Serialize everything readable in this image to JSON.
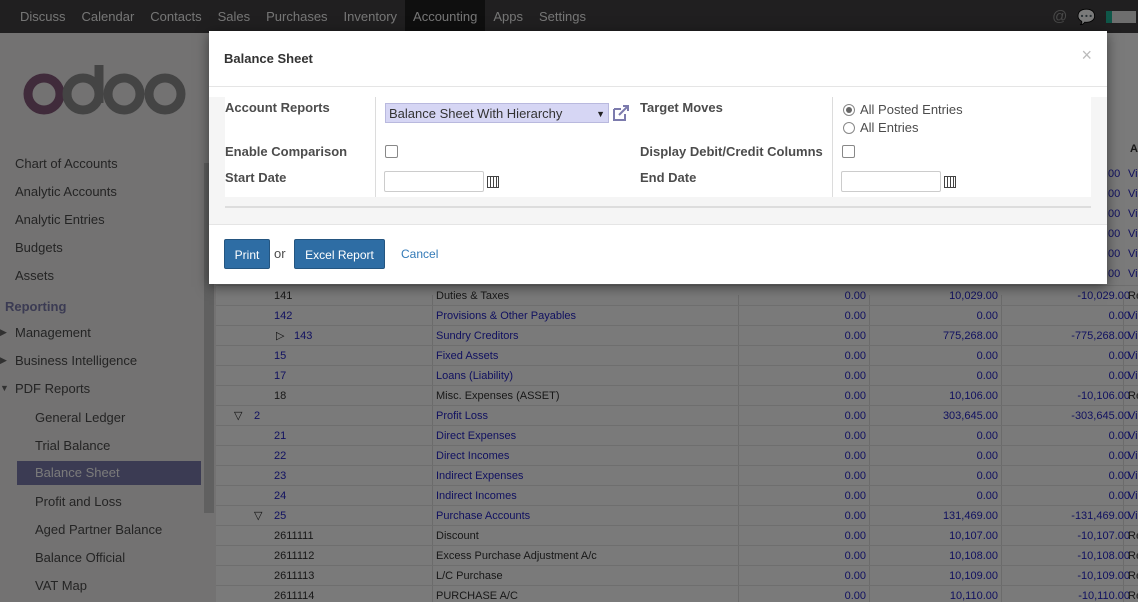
{
  "topbar": {
    "menu": [
      "Discuss",
      "Calendar",
      "Contacts",
      "Sales",
      "Purchases",
      "Inventory",
      "Accounting",
      "Apps",
      "Settings"
    ],
    "active": "Accounting",
    "icons": [
      "at-icon",
      "chat-icon"
    ]
  },
  "sidebar": {
    "logo": "odoo",
    "items": [
      "Chart of Accounts",
      "Analytic Accounts",
      "Analytic Entries",
      "Budgets",
      "Assets"
    ],
    "reporting_header": "Reporting",
    "groups": [
      "Management",
      "Business Intelligence",
      "PDF Reports"
    ],
    "pdf_reports": [
      "General Ledger",
      "Trial Balance",
      "Balance Sheet",
      "Profit and Loss",
      "Aged Partner Balance",
      "Balance Official",
      "VAT Map"
    ],
    "active": "Balance Sheet"
  },
  "table": {
    "rows": [
      {
        "code": "141",
        "name": "Duties & Taxes",
        "a": "0.00",
        "b": "10,029.00",
        "c": "-10,029.00",
        "v": "Re",
        "link": false
      },
      {
        "code": "142",
        "name": "Provisions & Other Payables",
        "a": "0.00",
        "b": "0.00",
        "c": "0.00",
        "v": "Vi",
        "link": true
      },
      {
        "code": "143",
        "name": "Sundry Creditors",
        "a": "0.00",
        "b": "775,268.00",
        "c": "-775,268.00",
        "v": "Vi",
        "link": true,
        "toggle": "right"
      },
      {
        "code": "15",
        "name": "Fixed Assets",
        "a": "0.00",
        "b": "0.00",
        "c": "0.00",
        "v": "Vi",
        "link": true
      },
      {
        "code": "17",
        "name": "Loans (Liability)",
        "a": "0.00",
        "b": "0.00",
        "c": "0.00",
        "v": "Vi",
        "link": true
      },
      {
        "code": "18",
        "name": "Misc. Expenses (ASSET)",
        "a": "0.00",
        "b": "10,106.00",
        "c": "-10,106.00",
        "v": "Re",
        "link": false
      },
      {
        "code": "2",
        "name": "Profit Loss",
        "a": "0.00",
        "b": "303,645.00",
        "c": "-303,645.00",
        "v": "Vi",
        "link": true,
        "toggle": "down"
      },
      {
        "code": "21",
        "name": "Direct Expenses",
        "a": "0.00",
        "b": "0.00",
        "c": "0.00",
        "v": "Vi",
        "link": true
      },
      {
        "code": "22",
        "name": "Direct Incomes",
        "a": "0.00",
        "b": "0.00",
        "c": "0.00",
        "v": "Vi",
        "link": true
      },
      {
        "code": "23",
        "name": "Indirect Expenses",
        "a": "0.00",
        "b": "0.00",
        "c": "0.00",
        "v": "Vi",
        "link": true
      },
      {
        "code": "24",
        "name": "Indirect Incomes",
        "a": "0.00",
        "b": "0.00",
        "c": "0.00",
        "v": "Vi",
        "link": true
      },
      {
        "code": "25",
        "name": "Purchase Accounts",
        "a": "0.00",
        "b": "131,469.00",
        "c": "-131,469.00",
        "v": "Vi",
        "link": true,
        "toggle": "down"
      },
      {
        "code": "2611111",
        "name": "Discount",
        "a": "0.00",
        "b": "10,107.00",
        "c": "-10,107.00",
        "v": "Re",
        "link": false
      },
      {
        "code": "2611112",
        "name": "Excess Purchase Adjustment A/c",
        "a": "0.00",
        "b": "10,108.00",
        "c": "-10,108.00",
        "v": "Re",
        "link": false
      },
      {
        "code": "2611113",
        "name": "L/C Purchase",
        "a": "0.00",
        "b": "10,109.00",
        "c": "-10,109.00",
        "v": "Re",
        "link": false
      },
      {
        "code": "2611114",
        "name": "PURCHASE A/C",
        "a": "0.00",
        "b": "10,110.00",
        "c": "-10,110.00",
        "v": "Re",
        "link": false
      }
    ],
    "hidden_top": [
      {
        "b": ".00",
        "v": "Vi"
      },
      {
        "b": ".00",
        "v": "Vi"
      },
      {
        "b": ".00",
        "v": "Vi"
      },
      {
        "b": ".00",
        "v": "Vi"
      },
      {
        "b": ".00",
        "v": "Vi"
      },
      {
        "b": ".00",
        "v": "Vi"
      }
    ],
    "header_tail": "A"
  },
  "modal": {
    "title": "Balance Sheet",
    "close": "×",
    "account_reports_label": "Account Reports",
    "account_reports_value": "Balance Sheet With Hierarchy",
    "target_moves_label": "Target Moves",
    "target_options": [
      "All Posted Entries",
      "All Entries"
    ],
    "enable_comparison_label": "Enable Comparison",
    "display_debit_credit_label": "Display Debit/Credit Columns",
    "start_date_label": "Start Date",
    "start_date_value": "",
    "end_date_label": "End Date",
    "end_date_value": "",
    "print_label": "Print",
    "or_label": "or",
    "excel_label": "Excel Report",
    "cancel_label": "Cancel"
  },
  "colors": {
    "accent": "#7c7bad",
    "primary_button": "#2e6da4",
    "link": "#2424c8"
  }
}
